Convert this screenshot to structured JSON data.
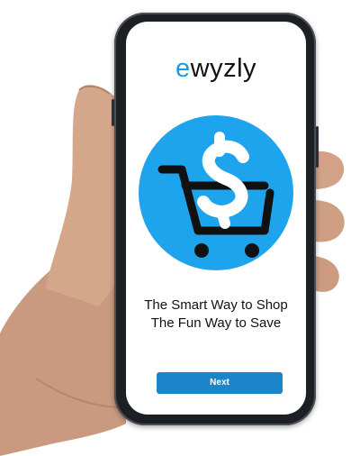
{
  "app": {
    "logo_prefix": "e",
    "logo_rest": "wyzly",
    "brand_color": "#1a9bdc"
  },
  "hero": {
    "icon": "cart-dollar-icon",
    "circle_color": "#1ea4ec"
  },
  "tagline": {
    "line1": "The Smart Way to Shop",
    "line2": "The Fun Way to Save"
  },
  "actions": {
    "next_label": "Next",
    "button_color": "#1a85c8"
  }
}
